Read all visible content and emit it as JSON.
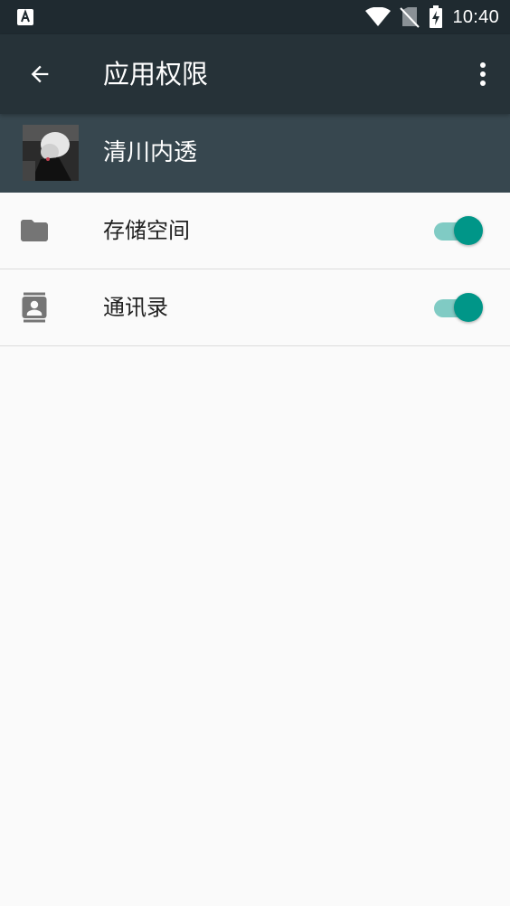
{
  "status_bar": {
    "time": "10:40",
    "left_icon": "a-notification-icon",
    "icons": [
      "wifi-icon",
      "no-sim-icon",
      "battery-charging-icon"
    ]
  },
  "app_bar": {
    "title": "应用权限",
    "back_icon": "arrow-back-icon",
    "overflow_icon": "more-vert-icon"
  },
  "app": {
    "name": "清川内透"
  },
  "permissions": [
    {
      "label": "存储空间",
      "icon": "folder-icon",
      "enabled": true
    },
    {
      "label": "通讯录",
      "icon": "contacts-icon",
      "enabled": true
    }
  ],
  "colors": {
    "status_bar": "#1f2a30",
    "app_bar": "#263238",
    "app_header": "#37474f",
    "accent": "#009688",
    "accent_track": "#80cbc4",
    "background": "#fafafa"
  }
}
